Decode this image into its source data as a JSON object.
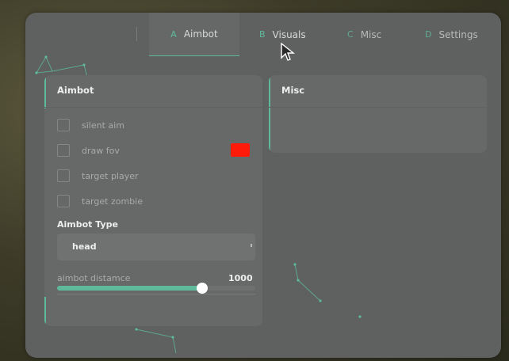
{
  "tabs": [
    {
      "letter": "A",
      "label": "Aimbot",
      "active": true
    },
    {
      "letter": "B",
      "label": "Visuals",
      "active": false
    },
    {
      "letter": "C",
      "label": "Misc",
      "active": false
    },
    {
      "letter": "D",
      "label": "Settings",
      "active": false
    }
  ],
  "aimbot_panel": {
    "title": "Aimbot",
    "options": [
      {
        "label": "silent aim",
        "checked": false
      },
      {
        "label": "draw fov",
        "checked": false,
        "color": "#ff1a0a"
      },
      {
        "label": "target player",
        "checked": false
      },
      {
        "label": "target zombie",
        "checked": false
      }
    ],
    "type_label": "Aimbot Type",
    "type_value": "head",
    "distance_label": "aimbot distamce",
    "distance_value": "1000",
    "distance_fill_fraction": 0.73
  },
  "misc_panel": {
    "title": "Misc"
  },
  "colors": {
    "accent": "#5fb99b",
    "window_bg": "#5f6060",
    "panel_bg": "#676868",
    "fov_color": "#ff1a0a"
  },
  "icons": {
    "cursor": "arrow-cursor-icon"
  }
}
